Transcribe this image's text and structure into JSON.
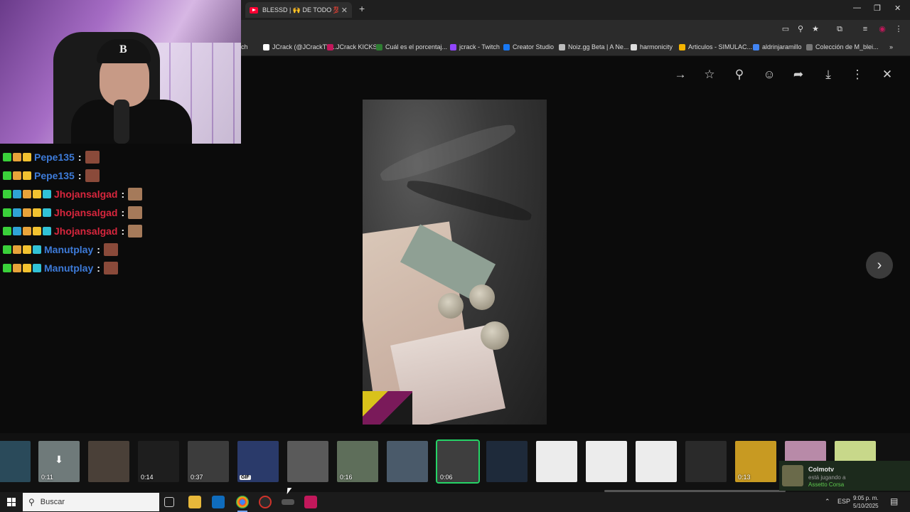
{
  "browser": {
    "tab_title": "BLESSD | 🙌 DE TODO 💯 - Yo",
    "tab_close": "✕",
    "new_tab": "+",
    "window_controls": {
      "minimize": "—",
      "restore": "❐",
      "close": "✕"
    },
    "toolbar_icons": [
      "screen-cast-icon",
      "zoom-icon",
      "star-icon",
      "extensions-icon",
      "media-icon",
      "profile-icon",
      "menu-icon"
    ],
    "bookmarks": [
      {
        "label": "ch",
        "color": "#888888"
      },
      {
        "label": "JCrack (@JCrackTV)...",
        "color": "#ffffff"
      },
      {
        "label": "JCrack KICKS",
        "color": "#c2185b"
      },
      {
        "label": "Cuál es el porcentaj...",
        "color": "#2e7d32"
      },
      {
        "label": "jcrack - Twitch",
        "color": "#9146ff"
      },
      {
        "label": "Creator Studio",
        "color": "#1877f2"
      },
      {
        "label": "Noiz.gg Beta | A Ne...",
        "color": "#bbbbbb"
      },
      {
        "label": "harmonicity",
        "color": "#dddddd"
      },
      {
        "label": "Articulos - SIMULAC...",
        "color": "#f4b400"
      },
      {
        "label": "aldrinjaramillo",
        "color": "#4285f4"
      },
      {
        "label": "Colección de M_blei...",
        "color": "#777777"
      }
    ],
    "bookmarks_more": "»"
  },
  "viewer": {
    "next_label": "›"
  },
  "chat": [
    {
      "user": "Pepe135",
      "color": "#3d7bd9",
      "badges": [
        "#3ad13a",
        "#e8a33a",
        "#f2c230"
      ]
    },
    {
      "user": "Pepe135",
      "color": "#3d7bd9",
      "badges": [
        "#3ad13a",
        "#e8a33a",
        "#f2c230"
      ]
    },
    {
      "user": "Jhojansalgad",
      "color": "#d7263d",
      "badges": [
        "#3ad13a",
        "#2fa3d6",
        "#e8a33a",
        "#f2c230",
        "#31c2d6"
      ]
    },
    {
      "user": "Jhojansalgad",
      "color": "#d7263d",
      "badges": [
        "#3ad13a",
        "#2fa3d6",
        "#e8a33a",
        "#f2c230",
        "#31c2d6"
      ]
    },
    {
      "user": "Jhojansalgad",
      "color": "#d7263d",
      "badges": [
        "#3ad13a",
        "#2fa3d6",
        "#e8a33a",
        "#f2c230",
        "#31c2d6"
      ]
    },
    {
      "user": "Manutplay",
      "color": "#3d7bd9",
      "badges": [
        "#3ad13a",
        "#e8a33a",
        "#f2c230",
        "#31c2d6"
      ]
    },
    {
      "user": "Manutplay",
      "color": "#3d7bd9",
      "badges": [
        "#3ad13a",
        "#e8a33a",
        "#f2c230",
        "#31c2d6"
      ]
    }
  ],
  "thumbnails": [
    {
      "duration": "",
      "color": "#2a4a5a"
    },
    {
      "duration": "0:11",
      "color": "#6f7a7a",
      "download": true
    },
    {
      "duration": "",
      "color": "#4a4038"
    },
    {
      "duration": "0:14",
      "color": "#1e1e1e"
    },
    {
      "duration": "0:37",
      "color": "#3c3c3c"
    },
    {
      "duration": "",
      "color": "#2a3a6a",
      "badge": "GIF"
    },
    {
      "duration": "",
      "color": "#5a5a5a"
    },
    {
      "duration": "0:16",
      "color": "#5e6e5a"
    },
    {
      "duration": "",
      "color": "#4a5a6a"
    },
    {
      "duration": "0:06",
      "color": "#3e3e3e",
      "selected": true
    },
    {
      "duration": "",
      "color": "#1e2a3a"
    },
    {
      "duration": "",
      "color": "#ececec"
    },
    {
      "duration": "",
      "color": "#ececec"
    },
    {
      "duration": "",
      "color": "#ececec"
    },
    {
      "duration": "",
      "color": "#2a2a2a"
    },
    {
      "duration": "0:13",
      "color": "#c89a22"
    },
    {
      "duration": "",
      "color": "#b88aa8"
    },
    {
      "duration": "",
      "color": "#c8d88a"
    }
  ],
  "notification": {
    "name": "Colmotv",
    "status": "está jugando a",
    "game": "Assetto Corsa"
  },
  "taskbar": {
    "search_placeholder": "Buscar",
    "language": "ESP",
    "tray_arrow": "⌃",
    "time": "9:05 p. m.",
    "date": "5/10/2025"
  }
}
